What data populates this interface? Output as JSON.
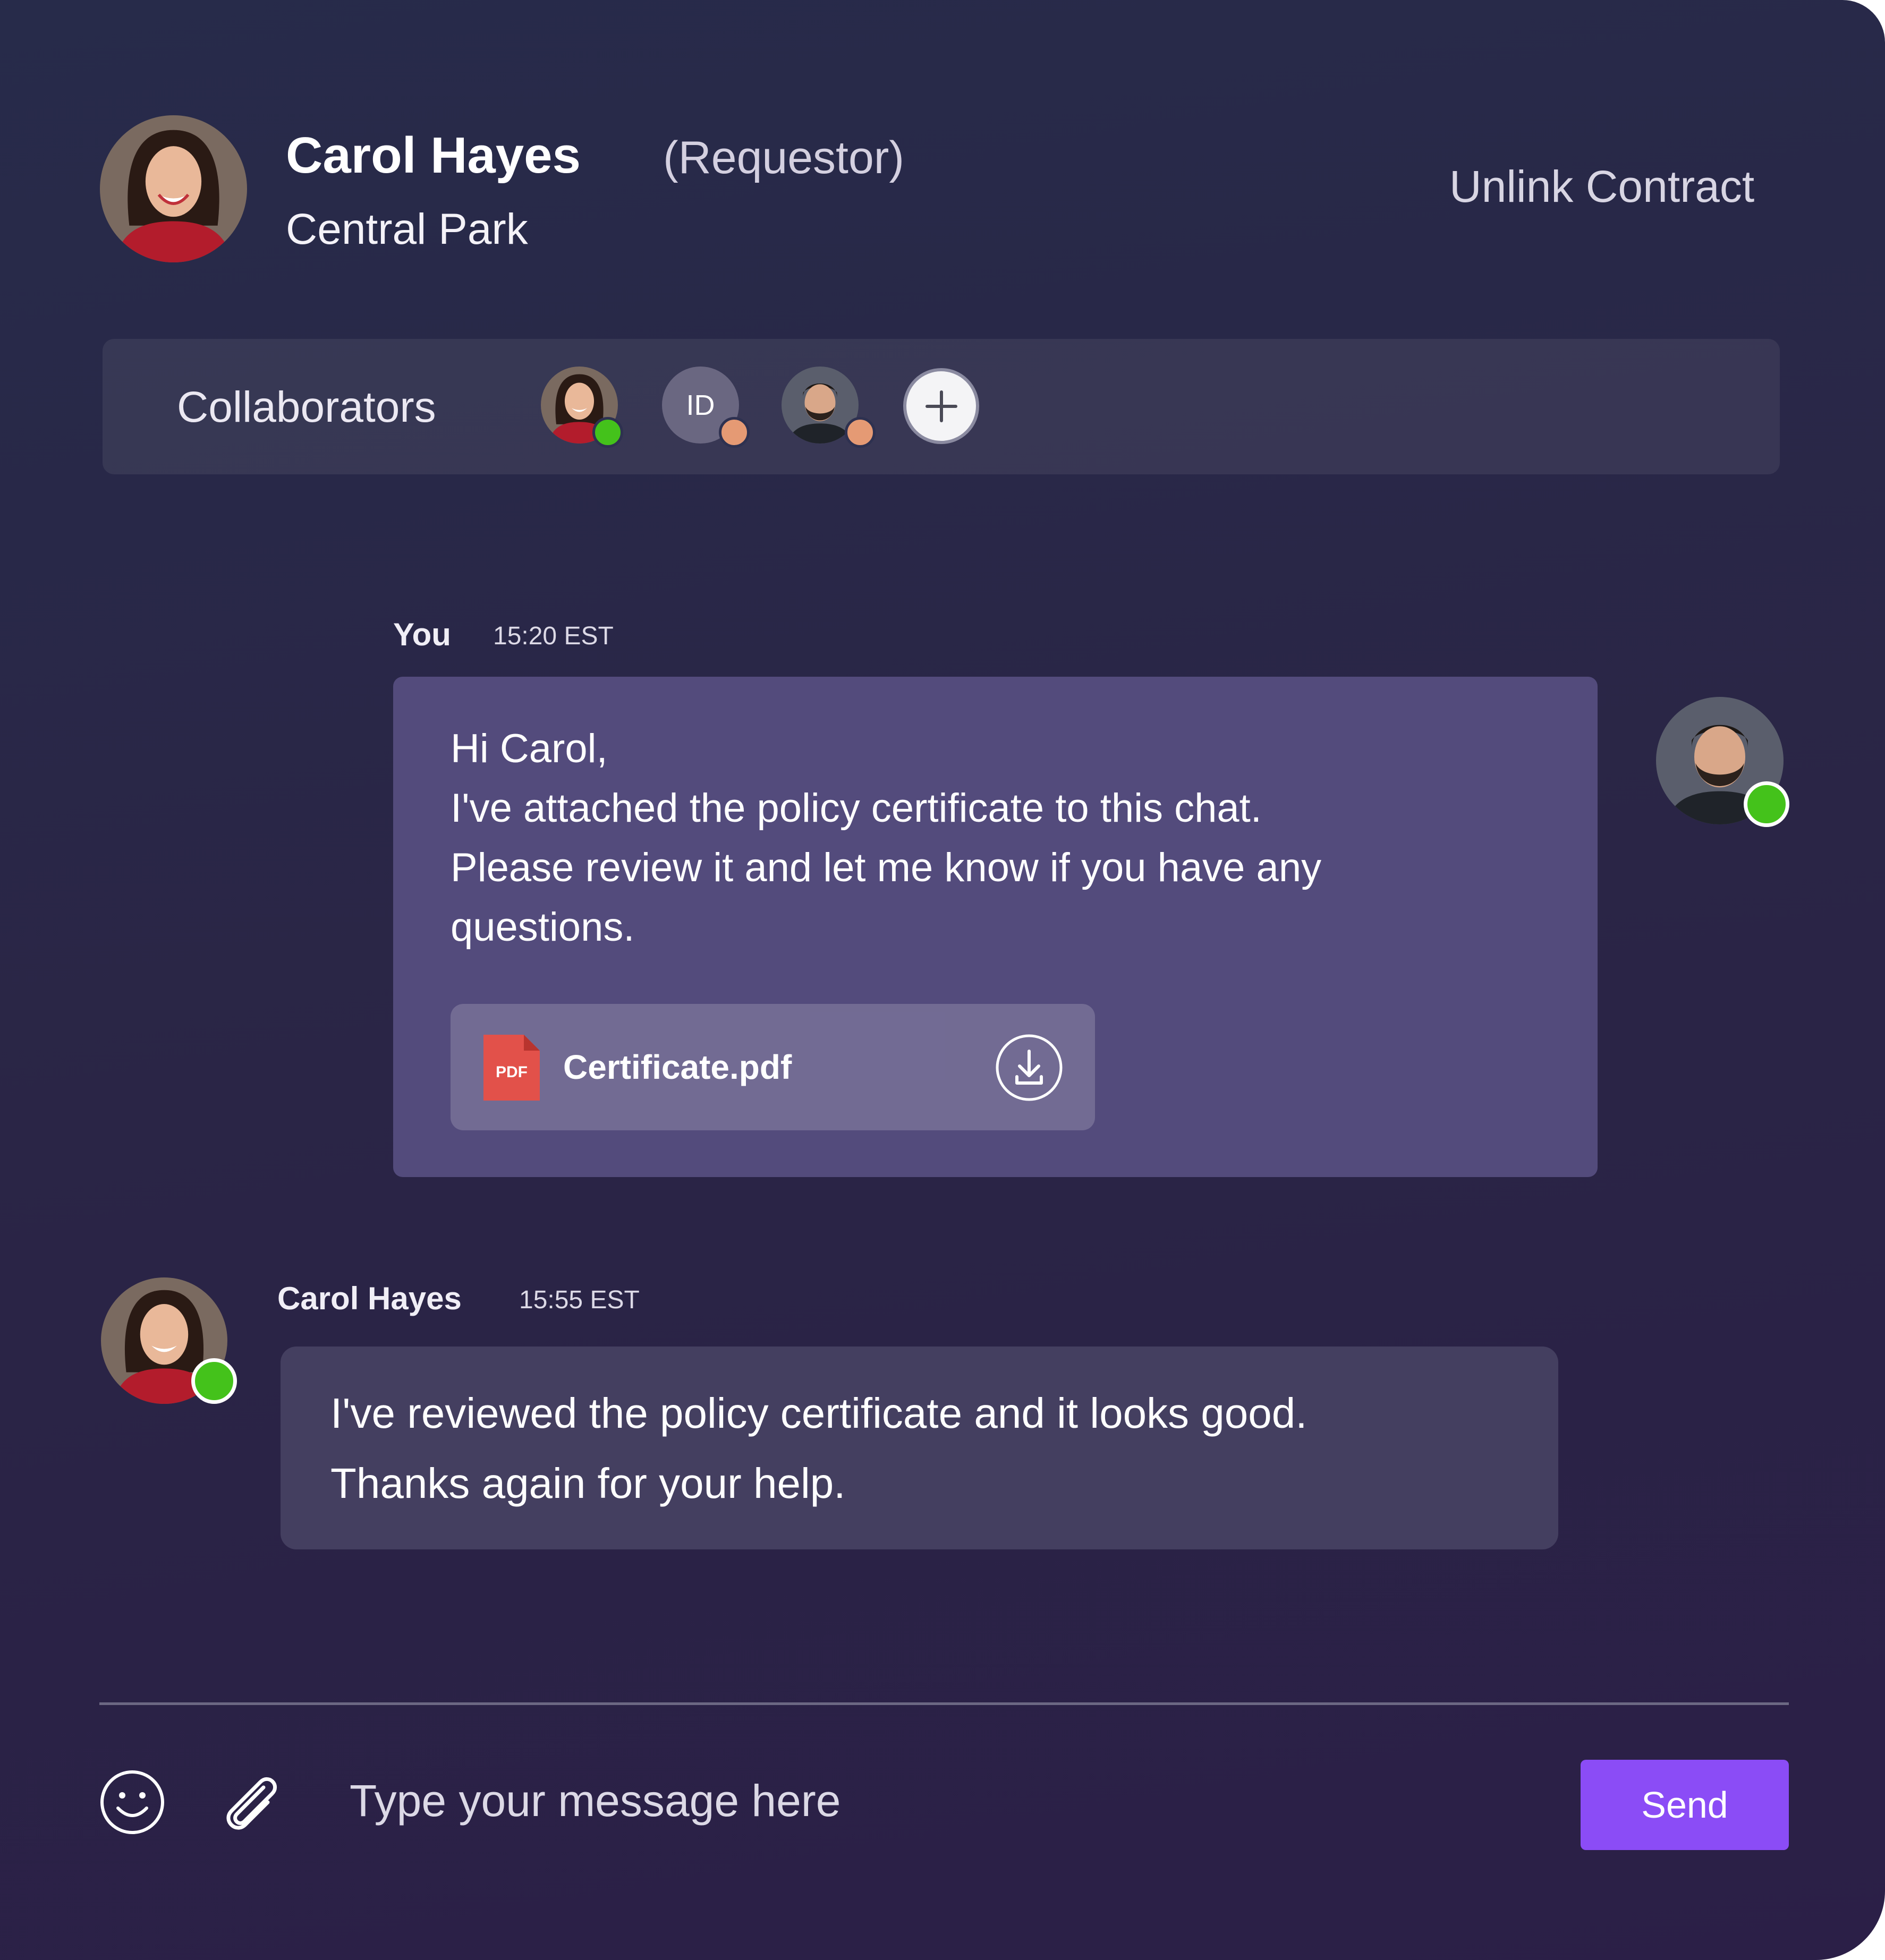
{
  "header": {
    "name": "Carol Hayes",
    "role": "(Requestor)",
    "location": "Central Park",
    "unlink_label": "Unlink Contract"
  },
  "collaborators": {
    "label": "Collaborators",
    "items": [
      {
        "kind": "photo",
        "avatar": "woman-avatar",
        "status": "online",
        "status_color": "#44c21b"
      },
      {
        "kind": "initials",
        "initials": "ID",
        "status": "away",
        "status_color": "#e59a74"
      },
      {
        "kind": "photo",
        "avatar": "man-avatar",
        "status": "away",
        "status_color": "#e59a74"
      }
    ],
    "add_icon": "plus-icon"
  },
  "messages": [
    {
      "sender": "You",
      "time": "15:20 EST",
      "lines": [
        "Hi Carol,",
        "I've attached the policy certificate to this chat.",
        "Please review it and let me know if you have any",
        "questions."
      ],
      "attachment": {
        "file_name": "Certificate.pdf",
        "file_badge": "PDF",
        "download_icon": "download-icon"
      },
      "avatar_status": "online"
    },
    {
      "sender": "Carol Hayes",
      "time": "15:55 EST",
      "lines": [
        "I've reviewed the policy certificate and it looks good.",
        "Thanks again for your help."
      ],
      "avatar_status": "online"
    }
  ],
  "composer": {
    "emoji_icon": "smiley-icon",
    "attach_icon": "paperclip-icon",
    "placeholder": "Type your message here",
    "value": "",
    "send_label": "Send"
  },
  "colors": {
    "accent": "#8b4cf6",
    "online": "#44c21b",
    "away": "#e59a74",
    "pdf_red": "#e2514a"
  }
}
